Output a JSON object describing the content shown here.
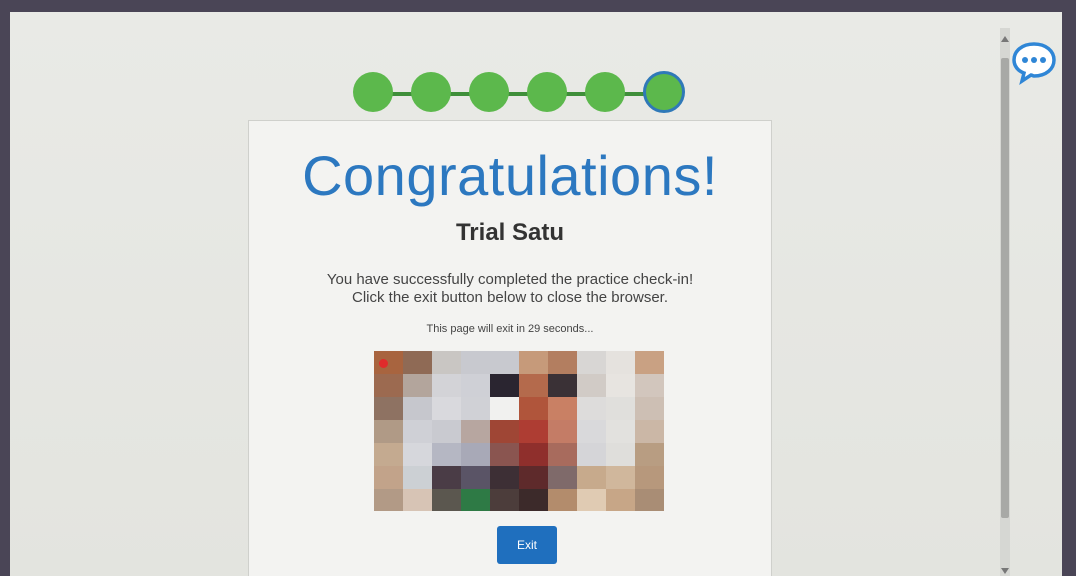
{
  "progress": {
    "total_steps": 6,
    "completed_steps": 5,
    "current_step": 6,
    "completed_color": "#5cb84c",
    "current_border_color": "#2f79b8"
  },
  "card": {
    "title": "Congratulations!",
    "subtitle": "Trial Satu",
    "message_line1": "You have successfully completed the practice check-in!",
    "message_line2": "Click the exit button below to close the browser.",
    "countdown": "This page will exit in 29 seconds..."
  },
  "webcam": {
    "recording_indicator_color": "#e02b2b",
    "pixelated": true
  },
  "actions": {
    "exit_label": "Exit",
    "exit_color": "#1f6fbe"
  },
  "chat": {
    "icon": "chat-bubble-icon",
    "color": "#2f86d6"
  },
  "colors": {
    "title": "#2c78c0",
    "background": "#e6e7e3"
  }
}
